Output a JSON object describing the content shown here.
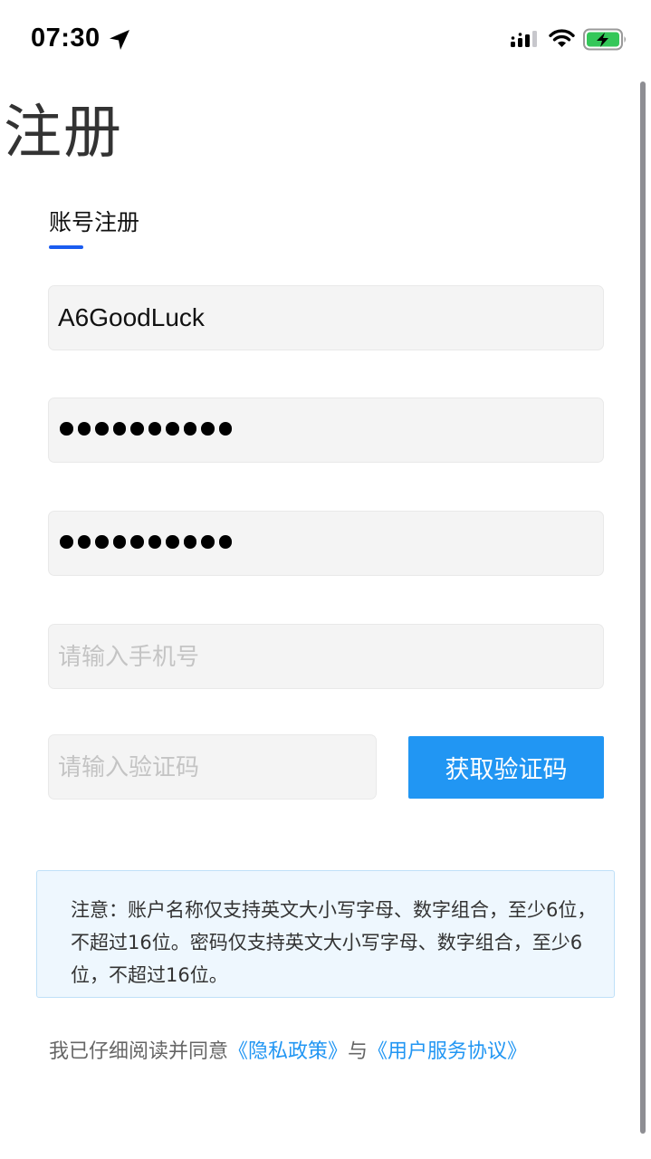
{
  "status_bar": {
    "time": "07:30",
    "icons": [
      "location-arrow-icon",
      "cellular-signal-icon",
      "wifi-icon",
      "battery-charging-icon"
    ]
  },
  "page": {
    "title": "注册"
  },
  "tab": {
    "label": "账号注册",
    "active": true
  },
  "form": {
    "username": {
      "value": "A6GoodLuck",
      "placeholder": ""
    },
    "password": {
      "mask_count": 10
    },
    "confirm_password": {
      "mask_count": 10
    },
    "phone": {
      "value": "",
      "placeholder": "请输入手机号"
    },
    "code": {
      "value": "",
      "placeholder": "请输入验证码"
    },
    "get_code_button": "获取验证码"
  },
  "notice": {
    "text": "注意：账户名称仅支持英文大小写字母、数字组合，至少6位，不超过16位。密码仅支持英文大小写字母、数字组合，至少6位，不超过16位。"
  },
  "agreement": {
    "prefix": "我已仔细阅读并同意",
    "privacy_link": "《隐私政策》",
    "connector": "与",
    "terms_link": "《用户服务协议》"
  },
  "colors": {
    "accent_blue": "#2196f3",
    "tab_underline": "#1a5cf0",
    "notice_bg": "#eef7fe",
    "field_bg": "#f4f4f4"
  }
}
